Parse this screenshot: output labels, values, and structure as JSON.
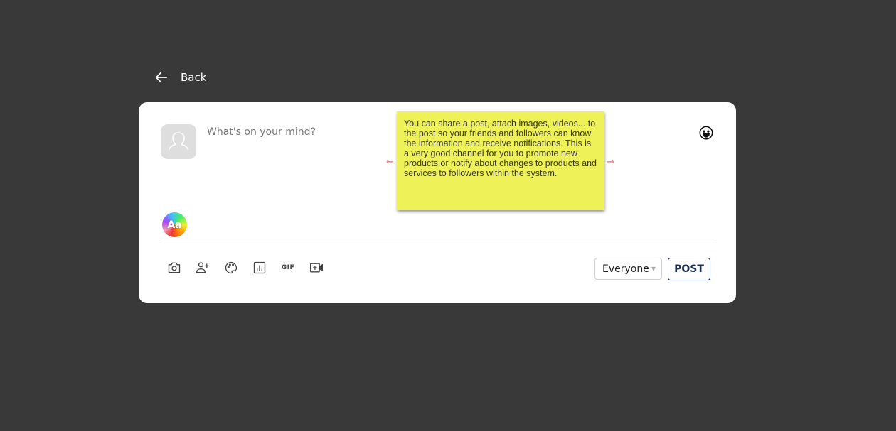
{
  "nav": {
    "back_label": "Back"
  },
  "composer": {
    "placeholder": "What's on your mind?",
    "text_style_label": "Aa"
  },
  "toolbar": {
    "tools": [
      {
        "name": "camera-icon"
      },
      {
        "name": "tag-people-icon"
      },
      {
        "name": "palette-icon"
      },
      {
        "name": "poll-icon"
      },
      {
        "name": "gif-icon",
        "label": "GIF"
      },
      {
        "name": "add-video-icon"
      }
    ],
    "audience": "Everyone",
    "post_label": "POST"
  },
  "tooltip": {
    "text": "You can share a post, attach images, videos... to the post so your friends and followers can know the information and receive notifications. This is a very good channel for you to promote new products or notify about changes to products and services to followers within the system.",
    "prev_arrow": "←",
    "next_arrow": "→"
  },
  "colors": {
    "background": "#393939",
    "card": "#ffffff",
    "post_accent": "#1c2f55",
    "tooltip_bg": "#eff158",
    "arrow": "#f38b8b"
  }
}
